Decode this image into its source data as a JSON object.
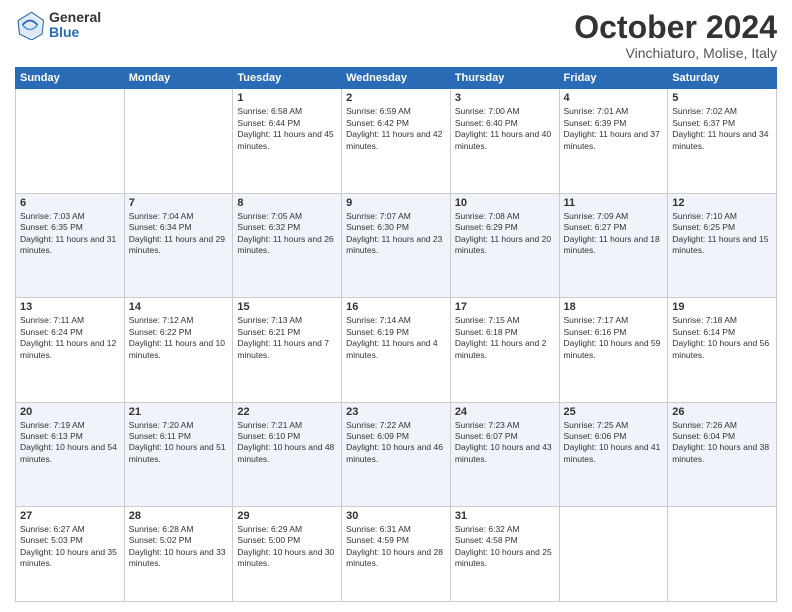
{
  "header": {
    "logo_general": "General",
    "logo_blue": "Blue",
    "title": "October 2024",
    "location": "Vinchiaturo, Molise, Italy"
  },
  "weekdays": [
    "Sunday",
    "Monday",
    "Tuesday",
    "Wednesday",
    "Thursday",
    "Friday",
    "Saturday"
  ],
  "weeks": [
    [
      {
        "date": "",
        "info": ""
      },
      {
        "date": "",
        "info": ""
      },
      {
        "date": "1",
        "info": "Sunrise: 6:58 AM\nSunset: 6:44 PM\nDaylight: 11 hours and 45 minutes."
      },
      {
        "date": "2",
        "info": "Sunrise: 6:59 AM\nSunset: 6:42 PM\nDaylight: 11 hours and 42 minutes."
      },
      {
        "date": "3",
        "info": "Sunrise: 7:00 AM\nSunset: 6:40 PM\nDaylight: 11 hours and 40 minutes."
      },
      {
        "date": "4",
        "info": "Sunrise: 7:01 AM\nSunset: 6:39 PM\nDaylight: 11 hours and 37 minutes."
      },
      {
        "date": "5",
        "info": "Sunrise: 7:02 AM\nSunset: 6:37 PM\nDaylight: 11 hours and 34 minutes."
      }
    ],
    [
      {
        "date": "6",
        "info": "Sunrise: 7:03 AM\nSunset: 6:35 PM\nDaylight: 11 hours and 31 minutes."
      },
      {
        "date": "7",
        "info": "Sunrise: 7:04 AM\nSunset: 6:34 PM\nDaylight: 11 hours and 29 minutes."
      },
      {
        "date": "8",
        "info": "Sunrise: 7:05 AM\nSunset: 6:32 PM\nDaylight: 11 hours and 26 minutes."
      },
      {
        "date": "9",
        "info": "Sunrise: 7:07 AM\nSunset: 6:30 PM\nDaylight: 11 hours and 23 minutes."
      },
      {
        "date": "10",
        "info": "Sunrise: 7:08 AM\nSunset: 6:29 PM\nDaylight: 11 hours and 20 minutes."
      },
      {
        "date": "11",
        "info": "Sunrise: 7:09 AM\nSunset: 6:27 PM\nDaylight: 11 hours and 18 minutes."
      },
      {
        "date": "12",
        "info": "Sunrise: 7:10 AM\nSunset: 6:25 PM\nDaylight: 11 hours and 15 minutes."
      }
    ],
    [
      {
        "date": "13",
        "info": "Sunrise: 7:11 AM\nSunset: 6:24 PM\nDaylight: 11 hours and 12 minutes."
      },
      {
        "date": "14",
        "info": "Sunrise: 7:12 AM\nSunset: 6:22 PM\nDaylight: 11 hours and 10 minutes."
      },
      {
        "date": "15",
        "info": "Sunrise: 7:13 AM\nSunset: 6:21 PM\nDaylight: 11 hours and 7 minutes."
      },
      {
        "date": "16",
        "info": "Sunrise: 7:14 AM\nSunset: 6:19 PM\nDaylight: 11 hours and 4 minutes."
      },
      {
        "date": "17",
        "info": "Sunrise: 7:15 AM\nSunset: 6:18 PM\nDaylight: 11 hours and 2 minutes."
      },
      {
        "date": "18",
        "info": "Sunrise: 7:17 AM\nSunset: 6:16 PM\nDaylight: 10 hours and 59 minutes."
      },
      {
        "date": "19",
        "info": "Sunrise: 7:18 AM\nSunset: 6:14 PM\nDaylight: 10 hours and 56 minutes."
      }
    ],
    [
      {
        "date": "20",
        "info": "Sunrise: 7:19 AM\nSunset: 6:13 PM\nDaylight: 10 hours and 54 minutes."
      },
      {
        "date": "21",
        "info": "Sunrise: 7:20 AM\nSunset: 6:11 PM\nDaylight: 10 hours and 51 minutes."
      },
      {
        "date": "22",
        "info": "Sunrise: 7:21 AM\nSunset: 6:10 PM\nDaylight: 10 hours and 48 minutes."
      },
      {
        "date": "23",
        "info": "Sunrise: 7:22 AM\nSunset: 6:09 PM\nDaylight: 10 hours and 46 minutes."
      },
      {
        "date": "24",
        "info": "Sunrise: 7:23 AM\nSunset: 6:07 PM\nDaylight: 10 hours and 43 minutes."
      },
      {
        "date": "25",
        "info": "Sunrise: 7:25 AM\nSunset: 6:06 PM\nDaylight: 10 hours and 41 minutes."
      },
      {
        "date": "26",
        "info": "Sunrise: 7:26 AM\nSunset: 6:04 PM\nDaylight: 10 hours and 38 minutes."
      }
    ],
    [
      {
        "date": "27",
        "info": "Sunrise: 6:27 AM\nSunset: 5:03 PM\nDaylight: 10 hours and 35 minutes."
      },
      {
        "date": "28",
        "info": "Sunrise: 6:28 AM\nSunset: 5:02 PM\nDaylight: 10 hours and 33 minutes."
      },
      {
        "date": "29",
        "info": "Sunrise: 6:29 AM\nSunset: 5:00 PM\nDaylight: 10 hours and 30 minutes."
      },
      {
        "date": "30",
        "info": "Sunrise: 6:31 AM\nSunset: 4:59 PM\nDaylight: 10 hours and 28 minutes."
      },
      {
        "date": "31",
        "info": "Sunrise: 6:32 AM\nSunset: 4:58 PM\nDaylight: 10 hours and 25 minutes."
      },
      {
        "date": "",
        "info": ""
      },
      {
        "date": "",
        "info": ""
      }
    ]
  ]
}
